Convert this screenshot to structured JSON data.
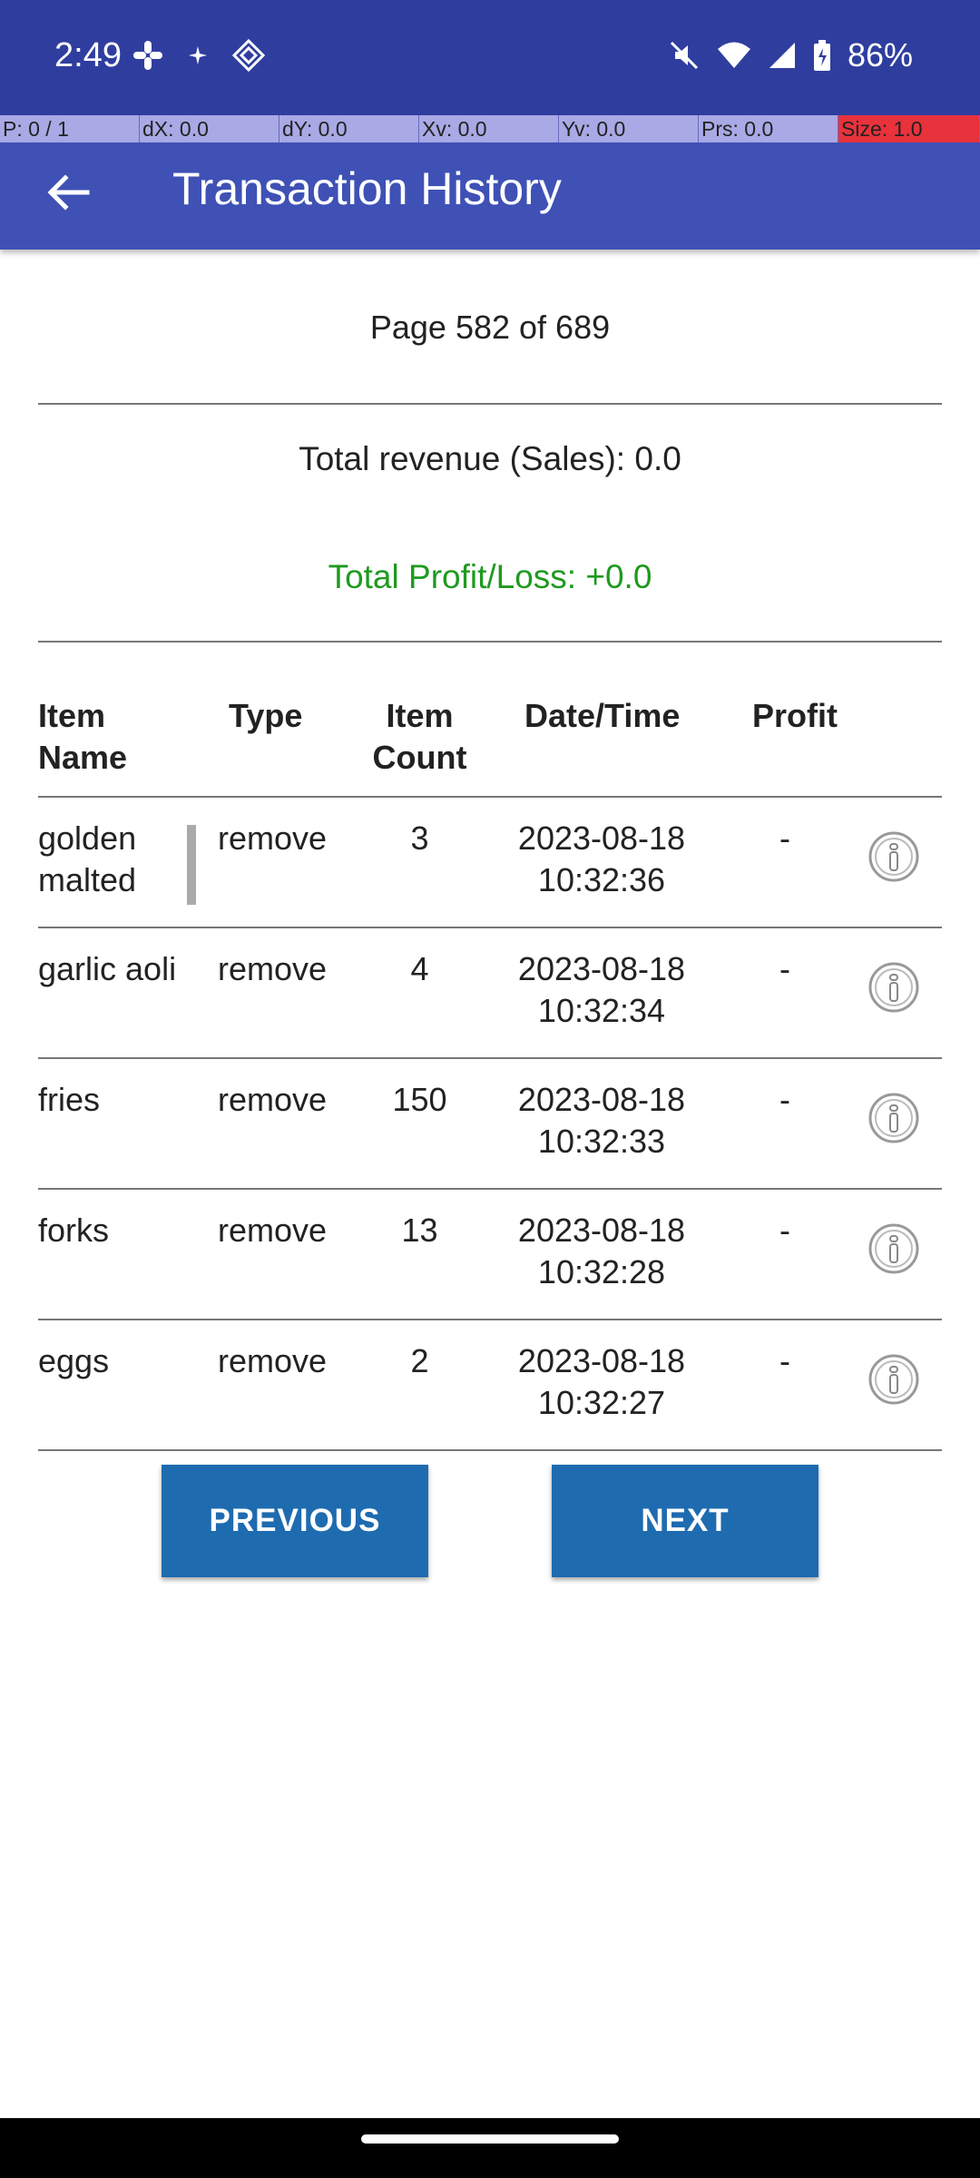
{
  "status_bar": {
    "time": "2:49",
    "battery": "86%",
    "icons_left": [
      "slack-icon",
      "sparkle-icon",
      "diamond-icon"
    ],
    "icons_right": [
      "mute-icon",
      "wifi-icon",
      "signal-icon",
      "battery-icon"
    ]
  },
  "debug_bar": {
    "p": "P: 0 / 1",
    "dx": "dX: 0.0",
    "dy": "dY: 0.0",
    "xv": "Xv: 0.0",
    "yv": "Yv: 0.0",
    "prs": "Prs: 0.0",
    "size": "Size: 1.0"
  },
  "app_bar": {
    "title": "Transaction History"
  },
  "page_info": "Page 582 of 689",
  "summary": {
    "revenue": "Total revenue (Sales): 0.0",
    "profit_loss": "Total Profit/Loss: +0.0"
  },
  "table": {
    "headers": {
      "name_1": "Item",
      "name_2": "Name",
      "type": "Type",
      "count_1": "Item",
      "count_2": "Count",
      "datetime": "Date/Time",
      "profit": "Profit"
    },
    "rows": [
      {
        "name": "golden malted waffle",
        "type": "remove",
        "count": "3",
        "date": "2023-08-18",
        "time": "10:32:36",
        "profit": "-"
      },
      {
        "name": "garlic aoli",
        "type": "remove",
        "count": "4",
        "date": "2023-08-18",
        "time": "10:32:34",
        "profit": "-"
      },
      {
        "name": "fries",
        "type": "remove",
        "count": "150",
        "date": "2023-08-18",
        "time": "10:32:33",
        "profit": "-"
      },
      {
        "name": "forks",
        "type": "remove",
        "count": "13",
        "date": "2023-08-18",
        "time": "10:32:28",
        "profit": "-"
      },
      {
        "name": "eggs",
        "type": "remove",
        "count": "2",
        "date": "2023-08-18",
        "time": "10:32:27",
        "profit": "-"
      }
    ]
  },
  "buttons": {
    "previous": "PREVIOUS",
    "next": "NEXT"
  },
  "colors": {
    "status_bar": "#2f3e9e",
    "app_bar": "#3f51b5",
    "button": "#1e6bb0",
    "profit_text": "#1f9a1f"
  }
}
